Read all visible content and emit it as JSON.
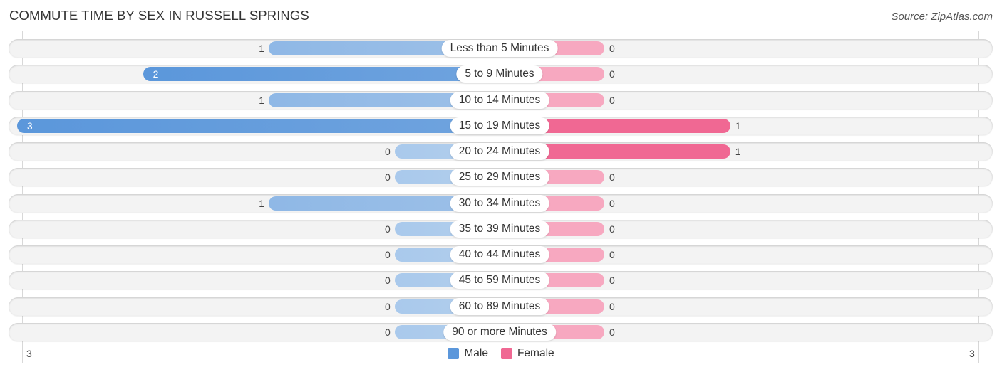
{
  "chart_data": {
    "type": "bar",
    "orientation": "horizontal-diverging",
    "title": "COMMUTE TIME BY SEX IN RUSSELL SPRINGS",
    "source": "Source: ZipAtlas.com",
    "categories": [
      "Less than 5 Minutes",
      "5 to 9 Minutes",
      "10 to 14 Minutes",
      "15 to 19 Minutes",
      "20 to 24 Minutes",
      "25 to 29 Minutes",
      "30 to 34 Minutes",
      "35 to 39 Minutes",
      "40 to 44 Minutes",
      "45 to 59 Minutes",
      "60 to 89 Minutes",
      "90 or more Minutes"
    ],
    "series": [
      {
        "name": "Male",
        "color": "#5b97db",
        "values": [
          1,
          2,
          1,
          3,
          0,
          0,
          1,
          0,
          0,
          0,
          0,
          0
        ]
      },
      {
        "name": "Female",
        "color": "#f06893",
        "values": [
          0,
          0,
          0,
          1,
          1,
          0,
          0,
          0,
          0,
          0,
          0,
          0
        ]
      }
    ],
    "axis": {
      "left_max_label": "3",
      "right_max_label": "3",
      "max": 3
    },
    "legend": {
      "position": "bottom-center",
      "items": [
        "Male",
        "Female"
      ]
    }
  }
}
